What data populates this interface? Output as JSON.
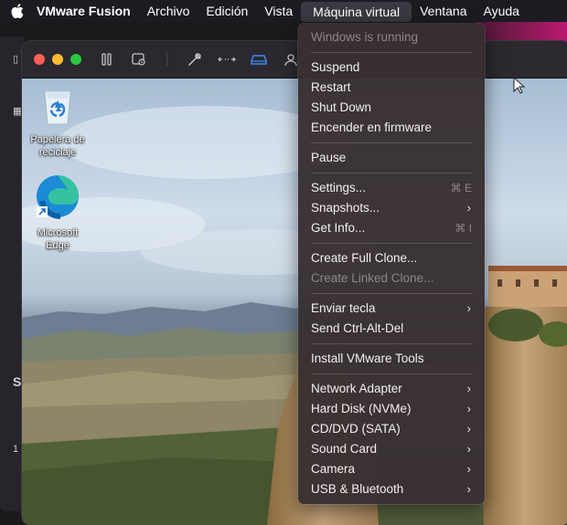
{
  "menubar": {
    "app_name": "VMware Fusion",
    "items": [
      "Archivo",
      "Edición",
      "Vista",
      "Máquina virtual",
      "Ventana",
      "Ayuda"
    ],
    "active_item": "Máquina virtual"
  },
  "host_window": {
    "sidebar_glyphs": [
      "S",
      "1"
    ]
  },
  "desktop": {
    "icons": [
      {
        "label": "Papelera de reciclaje"
      },
      {
        "label": "Microsoft Edge"
      }
    ]
  },
  "menu": {
    "status": "Windows is running",
    "power": [
      "Suspend",
      "Restart",
      "Shut Down",
      "Encender en firmware"
    ],
    "pause": "Pause",
    "settings": {
      "label": "Settings...",
      "shortcut": "⌘ E"
    },
    "snapshots": "Snapshots...",
    "get_info": {
      "label": "Get Info...",
      "shortcut": "⌘ I"
    },
    "full_clone": "Create Full Clone...",
    "linked_clone": "Create Linked Clone...",
    "send_key": "Enviar tecla",
    "ctrl_alt_del": "Send Ctrl-Alt-Del",
    "install_tools": "Install VMware Tools",
    "devices": [
      "Network Adapter",
      "Hard Disk (NVMe)",
      "CD/DVD (SATA)",
      "Sound Card",
      "Camera",
      "USB & Bluetooth"
    ]
  },
  "colors": {
    "menu_bg": "#383032",
    "disabled_text": "#8d8589",
    "toolbar_accent": "#3b8cf5"
  }
}
